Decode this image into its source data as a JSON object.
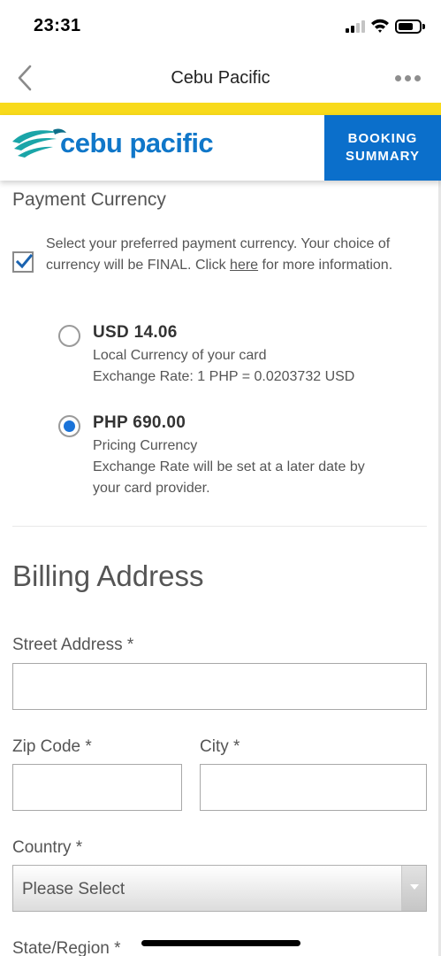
{
  "status_bar": {
    "time": "23:31"
  },
  "nav": {
    "title": "Cebu Pacific"
  },
  "brand": {
    "logo_text": "cebu pacific",
    "booking_summary_line1": "BOOKING",
    "booking_summary_line2": "SUMMARY",
    "colors": {
      "yellow": "#f8da1b",
      "blue": "#0b6fcb",
      "teal": "#1aa5a8"
    }
  },
  "payment_currency": {
    "title": "Payment Currency",
    "consent_checked": true,
    "disclaimer_before": "Select your preferred payment currency. Your choice of currency will be FINAL. Click ",
    "disclaimer_link": "here",
    "disclaimer_after": " for more information.",
    "options": [
      {
        "amount": "USD 14.06",
        "line1": "Local Currency of your card",
        "line2": "Exchange Rate: 1 PHP = 0.0203732 USD",
        "line3": "",
        "selected": false
      },
      {
        "amount": "PHP 690.00",
        "line1": "Pricing Currency",
        "line2": "Exchange Rate will be set at a later date by",
        "line3": "your card provider.",
        "selected": true
      }
    ]
  },
  "billing": {
    "title": "Billing Address",
    "street_label": "Street Address *",
    "street_value": "",
    "zip_label": "Zip Code *",
    "zip_value": "",
    "city_label": "City *",
    "city_value": "",
    "country_label": "Country *",
    "country_value": "Please Select",
    "state_label": "State/Region *"
  }
}
